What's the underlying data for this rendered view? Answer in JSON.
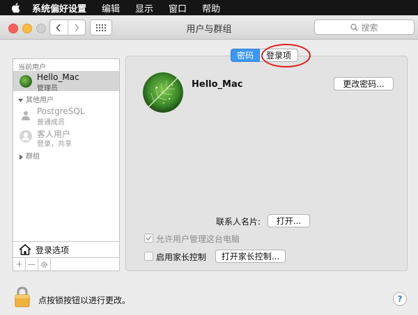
{
  "menubar": {
    "items": [
      "系统偏好设置",
      "编辑",
      "显示",
      "窗口",
      "帮助"
    ]
  },
  "window": {
    "title": "用户与群组",
    "search_placeholder": "搜索"
  },
  "sidebar": {
    "current_users_header": "当前用户",
    "current_user": {
      "name": "Hello_Mac",
      "role": "管理员"
    },
    "other_users_header": "其他用户",
    "other_users": [
      {
        "name": "PostgreSQL",
        "role": "普通成员"
      },
      {
        "name": "客人用户",
        "role": "登录，共享"
      }
    ],
    "groups_header": "群组",
    "login_options": "登录选项",
    "tools": {
      "add": "+",
      "remove": "—"
    }
  },
  "tabs": {
    "password": "密码",
    "login_items": "登录项"
  },
  "panel": {
    "user_name": "Hello_Mac",
    "change_password_button": "更改密码...",
    "contact_card_label": "联系人名片:",
    "open_button": "打开...",
    "allow_admin_label": "允许用户管理这台电脑",
    "parental_controls_label": "启用家长控制",
    "open_parental_controls_button": "打开家长控制..."
  },
  "footer": {
    "lock_text": "点按锁按钮以进行更改。",
    "help": "?"
  },
  "colors": {
    "accent": "#3d97f7",
    "highlight_circle": "#e01a1a",
    "close": "#fc605b",
    "minimize": "#fdbc40"
  }
}
